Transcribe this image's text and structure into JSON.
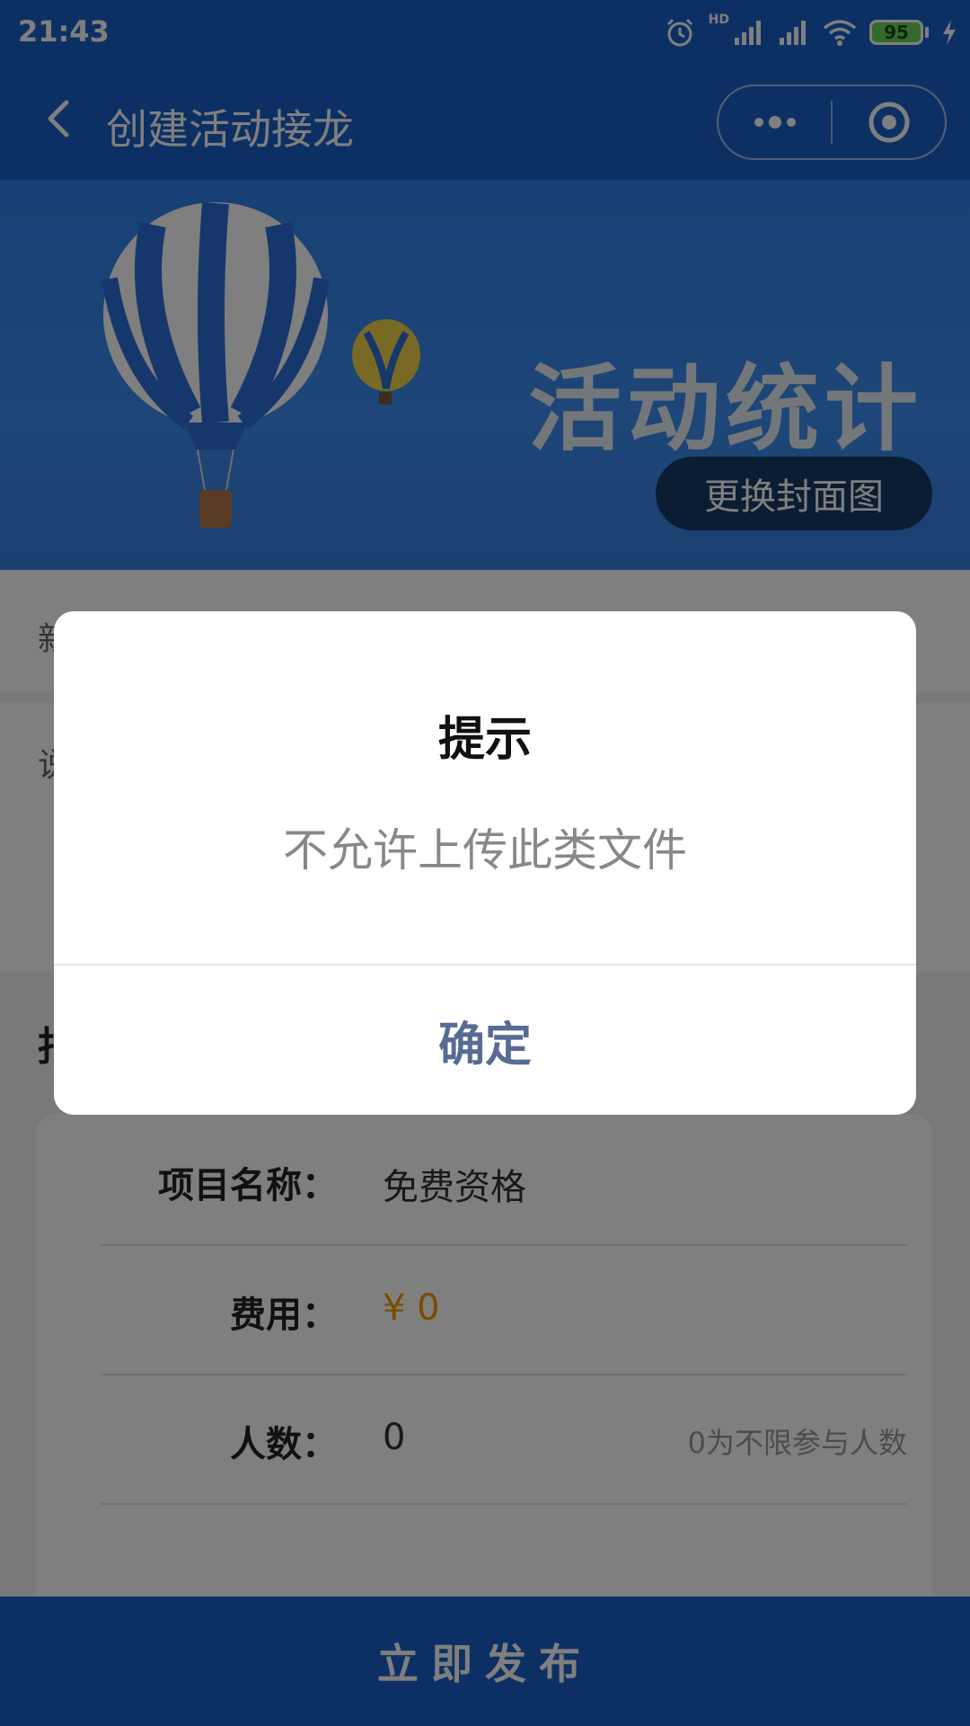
{
  "status_bar": {
    "time": "21:43",
    "network_badge": "HD",
    "battery": "95"
  },
  "nav": {
    "title": "创建活动接龙",
    "back_icon": "chevron-left-icon",
    "more_icon": "more-dots-icon",
    "close_icon": "target-icon"
  },
  "cover": {
    "title": "活动统计",
    "change_button": "更换封面图"
  },
  "page": {
    "row1_partial": "新",
    "row2_partial": "说",
    "section_partial": "报"
  },
  "items": [
    {
      "label": "项目名称：",
      "value": "免费资格",
      "hint": ""
    },
    {
      "label": "费用：",
      "currency": "¥",
      "value": "0",
      "hint": ""
    },
    {
      "label": "人数：",
      "value": "0",
      "hint": "0为不限参与人数"
    }
  ],
  "publish_button": "立即发布",
  "dialog": {
    "title": "提示",
    "message": "不允许上传此类文件",
    "confirm": "确定"
  },
  "colors": {
    "primary": "#1a61c9",
    "dialog_button": "#576b95",
    "price": "#f39800"
  }
}
